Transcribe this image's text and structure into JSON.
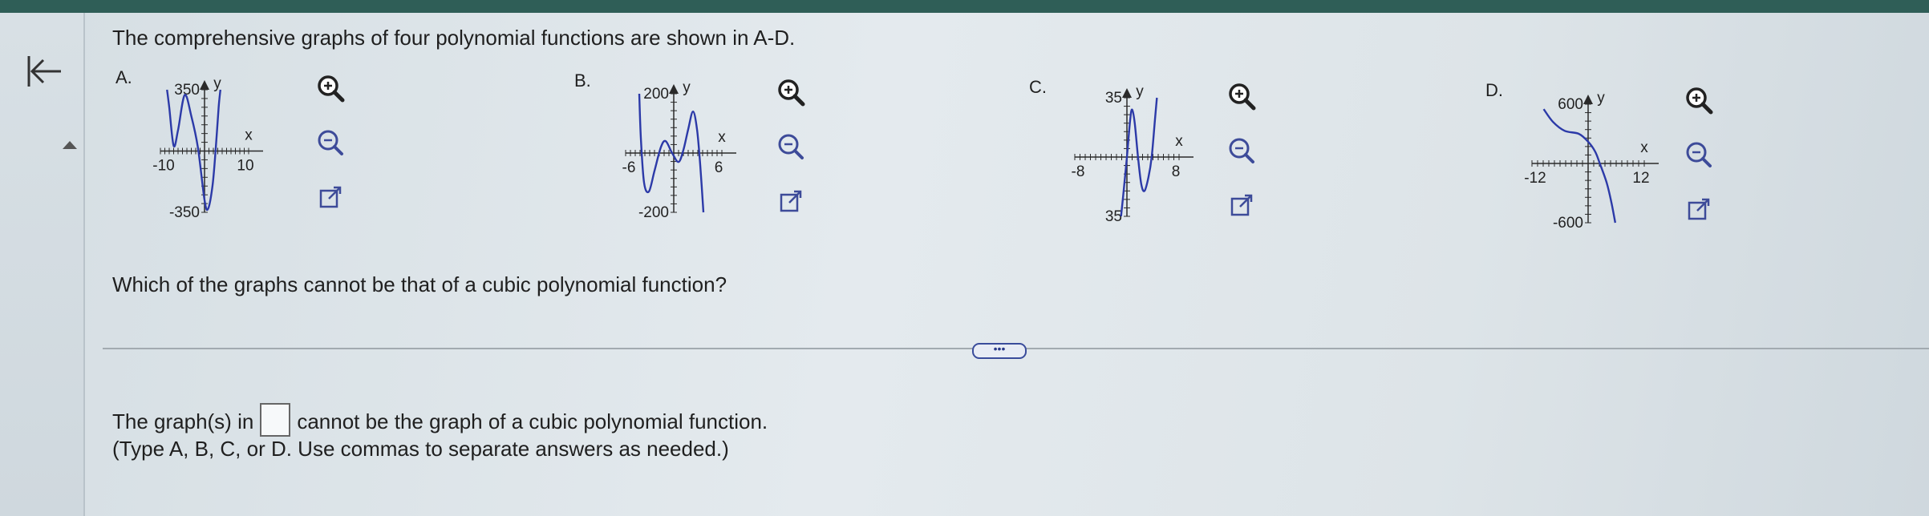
{
  "prompt": "The comprehensive graphs of four polynomial functions are shown in A-D.",
  "question": "Which of the graphs cannot be that of a cubic polynomial function?",
  "answer": {
    "before": "The graph(s) in",
    "after": "cannot be the graph of a cubic polynomial function.",
    "hint": "(Type A, B, C, or D. Use commas to separate answers as needed.)",
    "value": ""
  },
  "more_button": "•••",
  "colors": {
    "curve": "#2c3aa8",
    "axis": "#2a2a2a",
    "accent": "#3a4c9b"
  },
  "icons": [
    "back-arrow-icon",
    "zoom-in-icon",
    "zoom-out-icon",
    "open-external-icon"
  ],
  "graphs": [
    {
      "id": "A",
      "label": "A.",
      "x_min": -10,
      "x_max": 10,
      "y_min": -350,
      "y_max": 350,
      "y_top_label": "350",
      "y_bottom_label": "-350",
      "x_left_label": "-10",
      "x_right_label": "10",
      "x_axis_label": "x",
      "y_axis_label": "y",
      "curve": [
        [
          -8.5,
          350
        ],
        [
          -8,
          250
        ],
        [
          -7,
          30
        ],
        [
          -6,
          120
        ],
        [
          -4.5,
          320
        ],
        [
          -3,
          200
        ],
        [
          -1.5,
          20
        ],
        [
          0,
          -280
        ],
        [
          0.8,
          -330
        ],
        [
          1.8,
          -200
        ],
        [
          2.5,
          0
        ],
        [
          3.2,
          250
        ],
        [
          3.6,
          350
        ]
      ]
    },
    {
      "id": "B",
      "label": "B.",
      "x_min": -6,
      "x_max": 6,
      "y_min": -200,
      "y_max": 200,
      "y_top_label": "200",
      "y_bottom_label": "-200",
      "x_left_label": "-6",
      "x_right_label": "6",
      "x_axis_label": "x",
      "y_axis_label": "y",
      "curve": [
        [
          -4.3,
          200
        ],
        [
          -4.1,
          50
        ],
        [
          -3.7,
          -100
        ],
        [
          -3.1,
          -130
        ],
        [
          -2.4,
          -60
        ],
        [
          -1.6,
          20
        ],
        [
          -1,
          40
        ],
        [
          -0.2,
          0
        ],
        [
          0.6,
          -30
        ],
        [
          1.2,
          10
        ],
        [
          1.8,
          80
        ],
        [
          2.4,
          140
        ],
        [
          2.9,
          80
        ],
        [
          3.3,
          -40
        ],
        [
          3.7,
          -200
        ]
      ]
    },
    {
      "id": "C",
      "label": "C.",
      "x_min": -8,
      "x_max": 8,
      "y_min": -35,
      "y_max": 35,
      "y_top_label": "35",
      "y_bottom_label": "35",
      "x_left_label": "-8",
      "x_right_label": "8",
      "x_axis_label": "x",
      "y_axis_label": "y",
      "curve": [
        [
          -0.9,
          -35
        ],
        [
          -0.5,
          -20
        ],
        [
          0,
          0
        ],
        [
          0.5,
          22
        ],
        [
          0.8,
          28
        ],
        [
          1.2,
          20
        ],
        [
          1.7,
          0
        ],
        [
          2.2,
          -16
        ],
        [
          2.7,
          -20
        ],
        [
          3.3,
          -12
        ],
        [
          3.8,
          0
        ],
        [
          4.3,
          22
        ],
        [
          4.6,
          35
        ]
      ]
    },
    {
      "id": "D",
      "label": "D.",
      "x_min": -12,
      "x_max": 12,
      "y_min": -600,
      "y_max": 600,
      "y_top_label": "600",
      "y_bottom_label": "-600",
      "x_left_label": "-12",
      "x_right_label": "12",
      "x_axis_label": "x",
      "y_axis_label": "y",
      "curve": [
        [
          -9.5,
          550
        ],
        [
          -7.5,
          420
        ],
        [
          -5,
          330
        ],
        [
          -2,
          300
        ],
        [
          0,
          220
        ],
        [
          1.5,
          120
        ],
        [
          2.5,
          0
        ],
        [
          4,
          -200
        ],
        [
          5,
          -400
        ],
        [
          5.8,
          -600
        ]
      ]
    }
  ]
}
